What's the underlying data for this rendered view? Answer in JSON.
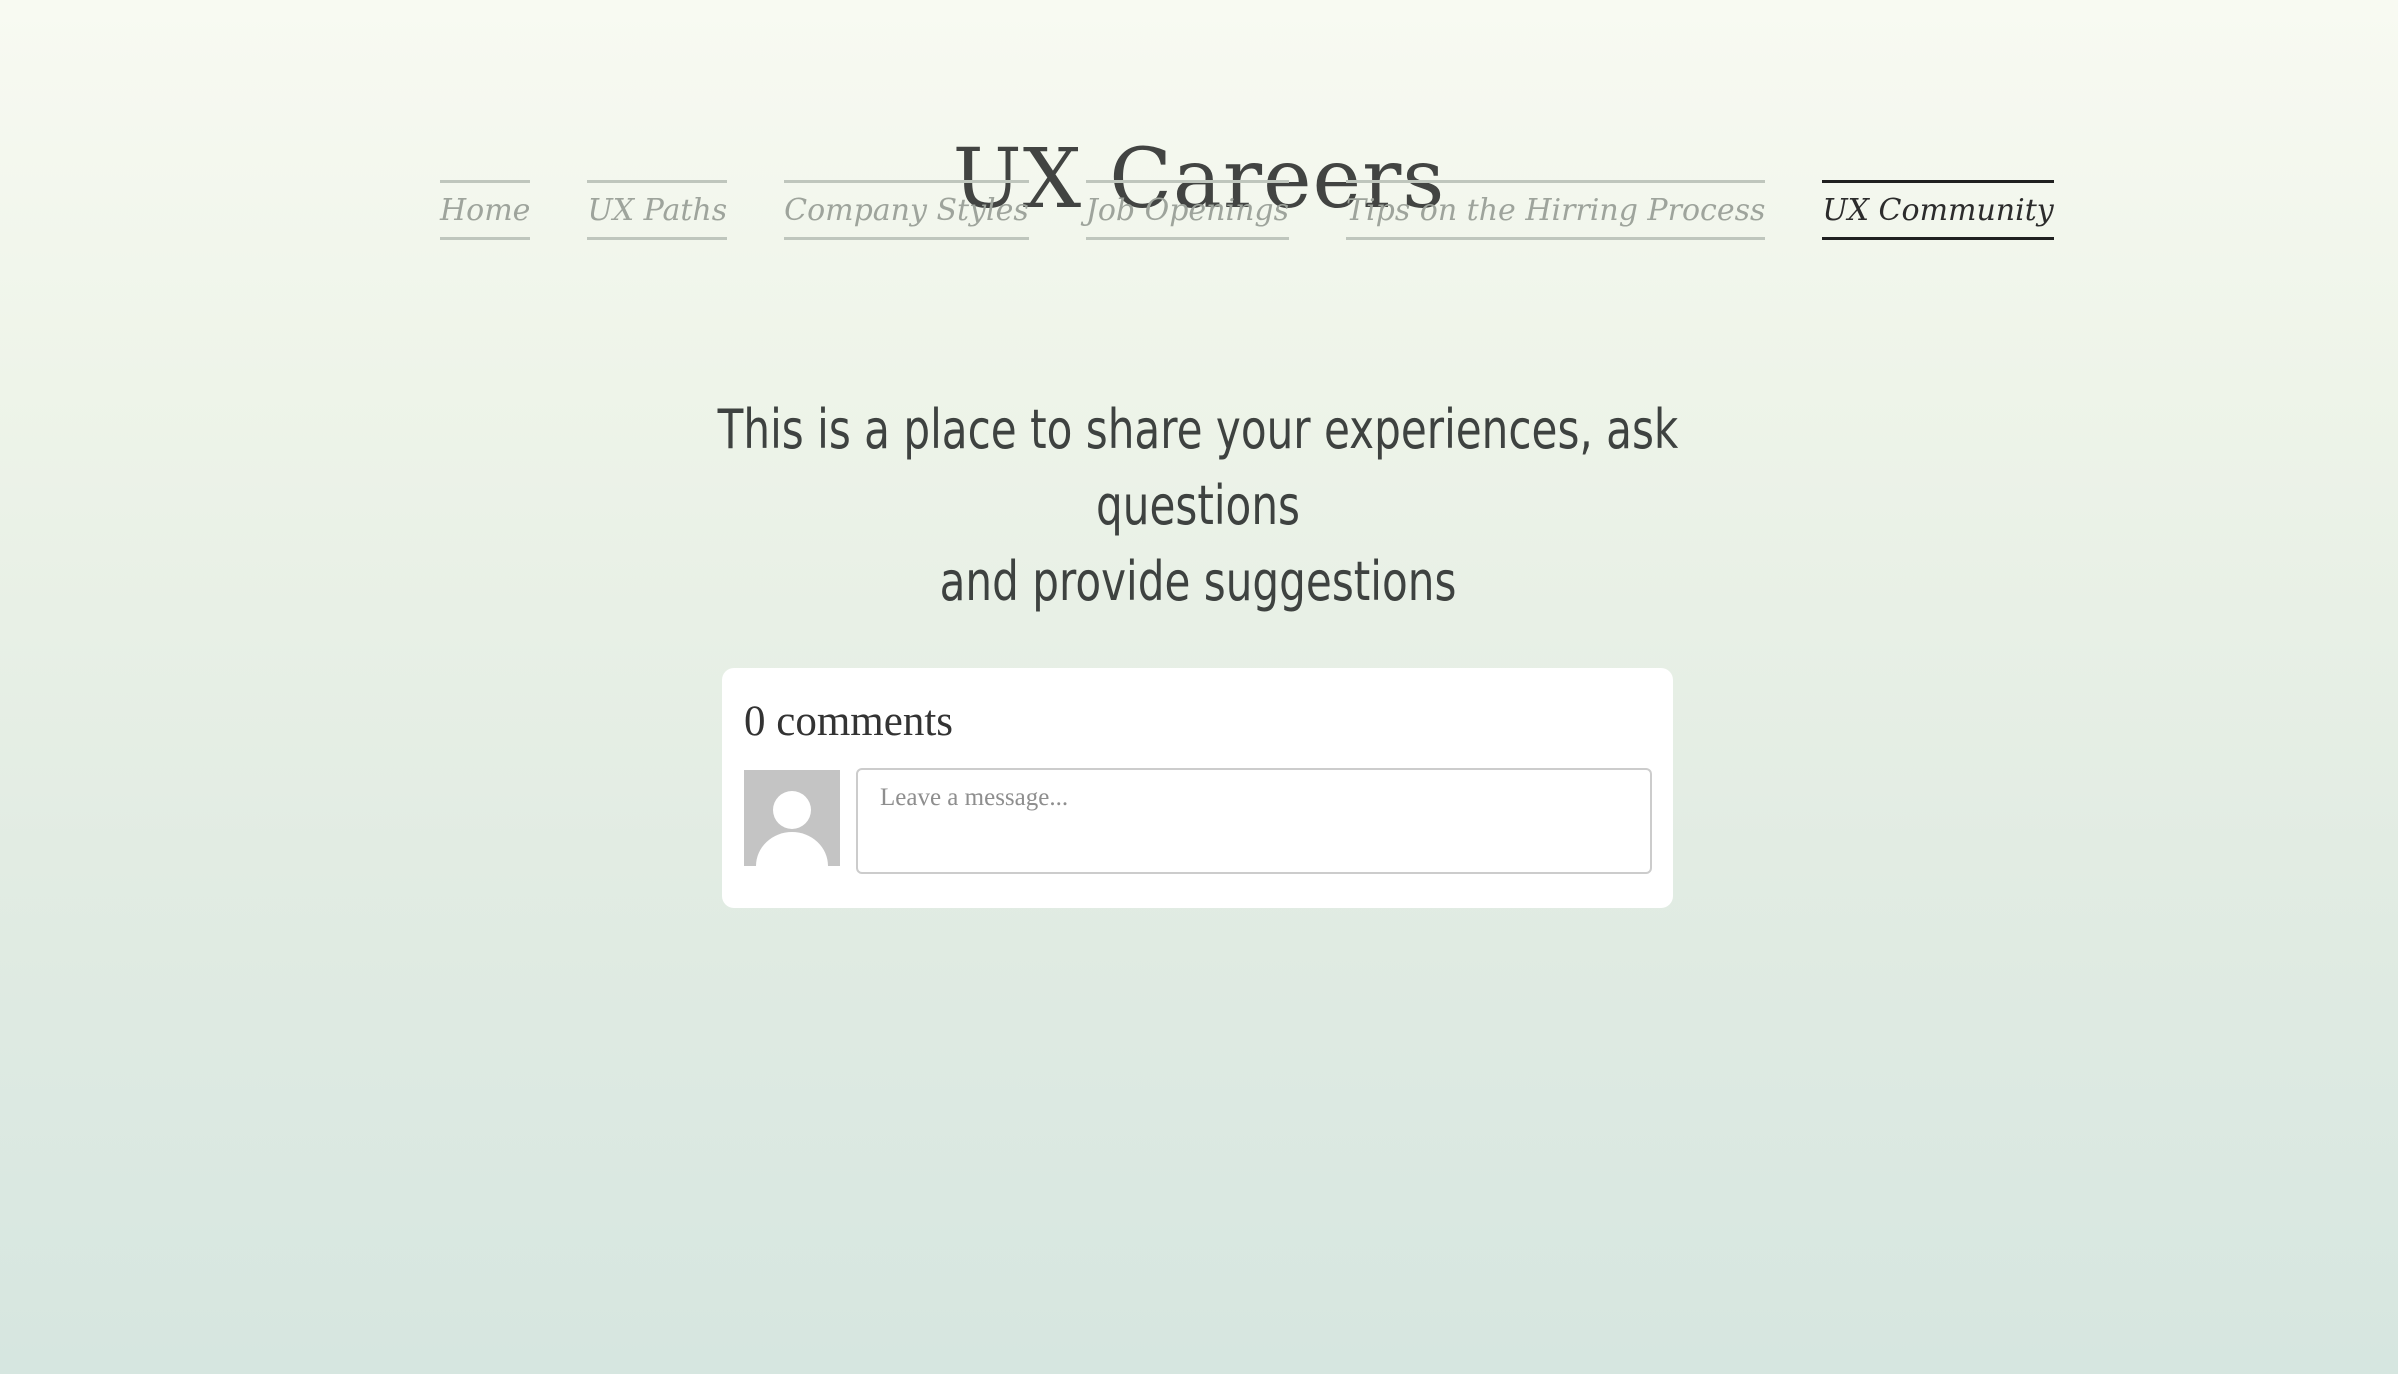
{
  "site": {
    "title": "UX Careers"
  },
  "nav": {
    "items": [
      {
        "label": "Home",
        "active": false
      },
      {
        "label": "UX Paths",
        "active": false
      },
      {
        "label": "Company Styles",
        "active": false
      },
      {
        "label": "Job Openings",
        "active": false
      },
      {
        "label": "Tips on the Hirring Process",
        "active": false
      },
      {
        "label": "UX Community",
        "active": true
      }
    ]
  },
  "main": {
    "tagline_line1": "This is a place to share your experiences, ask questions",
    "tagline_line2": "and provide suggestions"
  },
  "comments": {
    "count_label": "0 comments",
    "avatar_icon": "user-avatar-placeholder",
    "message_placeholder": "Leave a message..."
  },
  "colors": {
    "nav_active": "#202020",
    "nav_inactive": "#9ea49c",
    "text_dark": "#3e4240",
    "card_bg": "#ffffff"
  }
}
